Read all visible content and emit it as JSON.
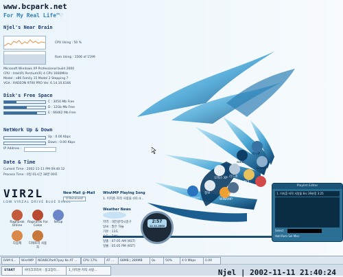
{
  "watermark": "www.bcpark.net",
  "header": {
    "life": "For My Real Life™♡",
    "brain": "Njel's Near Brain"
  },
  "cpu": {
    "label": "CPU Using : 50 %"
  },
  "ram": {
    "label": "Ram Using : 1506 of 1599"
  },
  "sysinfo": [
    "Microsoft Windows XP Professional          build 2600",
    "CPU :                         Intel(R) Pentium(R) 4 CPU 1600MHz",
    "Model : x86 Family 15 Model 2 Stepping 7",
    "VGA : RADEON 9700 PRO          Ver. 6.14.10.6166"
  ],
  "disk": {
    "title": "Disk's Free Space",
    "drives": [
      {
        "label": "C : 3050 Mb Free",
        "level": 0.3
      },
      {
        "label": "D : 12Gb Mb Free",
        "level": 0.55
      },
      {
        "label": "E : 66462 Mb Free",
        "level": 0.8
      }
    ]
  },
  "network": {
    "title": "NetWork Up & Down",
    "up": "Up : 0.00 Kbps",
    "down": "Down : 0.00 Kbps",
    "ip_label": "IP Address :"
  },
  "datetime": {
    "title": "Date & Time",
    "current": "Current Time : 2002-11-11  PM 09:40:12",
    "process": "Process Time : 0일 01시간 38분 00초"
  },
  "logo": {
    "main": "VIR2L",
    "sub": "LOW VIRZAL DRIVE   BLUE SHELL"
  },
  "mail": {
    "title": "New Mail @-Mail",
    "sub": "0 Received"
  },
  "playing": {
    "title": "WinAMP Playing Song",
    "sub": "1. 이지훈-자작 사랑을 (01:4..."
  },
  "weather": {
    "title": "Weather News",
    "lines": [
      "지역 : 대전광역시중구",
      "날씨 : 맑은 하늘",
      "기온 : 13도",
      "습도 : 74%",
      "일출 : 07:05 AM (KST)",
      "일몰 : 05:05 PM (KST)"
    ]
  },
  "desktop_icons": [
    {
      "label": "Ragnarok Online"
    },
    {
      "label": "Ragnarok For Coloz"
    },
    {
      "label": "Setup"
    },
    {
      "label": "다음캐"
    },
    {
      "label": "디렉토리 사용자"
    }
  ],
  "swirl_icons": [
    {
      "label": "Explorer"
    },
    {
      "label": "정보"
    },
    {
      "label": "WINAMP"
    },
    {
      "label": "리드미"
    },
    {
      "label": "폴더"
    },
    {
      "label": "게임"
    },
    {
      "label": "오피스 XP"
    },
    {
      "label": "ALSONG"
    }
  ],
  "swirl_top": [
    "www",
    "게시판",
    "bcpark"
  ],
  "dial": {
    "time": "2:57",
    "date": "11.11.2002"
  },
  "player": {
    "title": "Playlist Editor",
    "item": "1. 이지훈-자작 사랑을 8시 39분정   3:25",
    "buttons": [
      "Add",
      "Rem",
      "Sel",
      "Misc"
    ],
    "select": "Select"
  },
  "taskbar": {
    "row1": [
      "RAM 6...",
      "WinAMP",
      "NEWBCParK7pay Ke AT ...",
      "CPU 17%",
      "AT ...",
      "68MB | 289MB",
      "0x",
      "50%",
      "4 0 Mbps",
      "0.00"
    ],
    "row2": [
      "START",
      "바이크코리아 : 중고장터...",
      "1_이지훈-자작 사랑..."
    ],
    "clock": "Njel | 2002-11-11 21:40:24"
  }
}
